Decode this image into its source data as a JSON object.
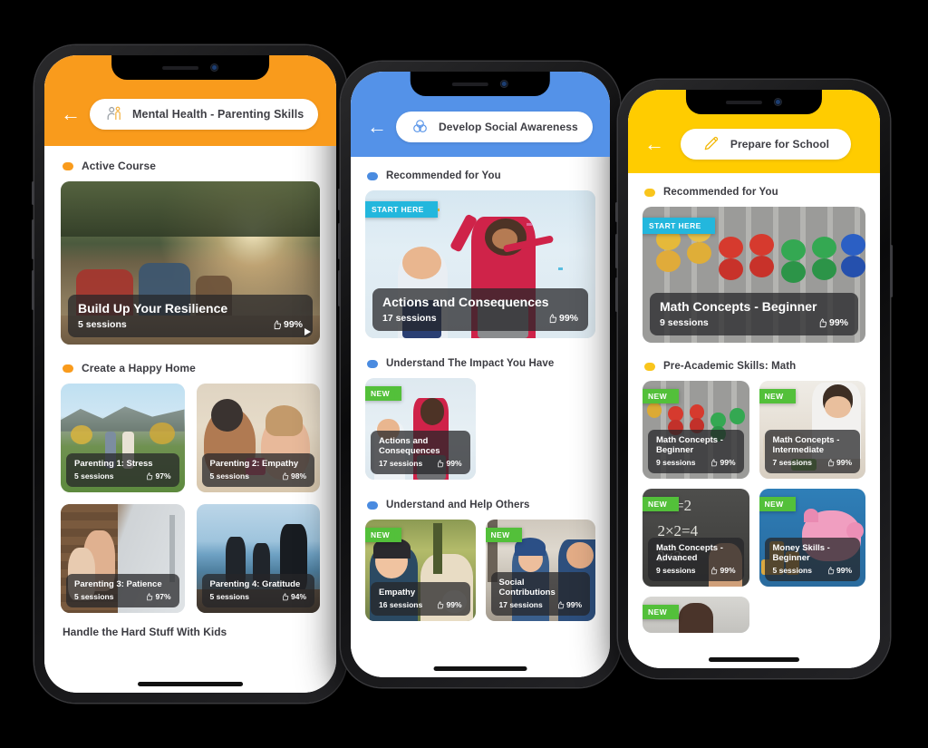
{
  "phones": [
    {
      "id": "phone-parenting",
      "accent": "#F99B1C",
      "header": {
        "back_label": "←",
        "icon": "parent-child-icon",
        "title": "Mental Health - Parenting Skills"
      },
      "sections": [
        {
          "label": "Active Course",
          "dot_color": "#F99B1C",
          "layout": "hero",
          "cards": [
            {
              "title": "Build Up Your Resilience",
              "sessions": "5 sessions",
              "rating": "99%",
              "badge": null,
              "play": true,
              "image": "family-sunset-lake"
            }
          ]
        },
        {
          "label": "Create a Happy Home",
          "dot_color": "#F99B1C",
          "layout": "grid2",
          "cards": [
            {
              "title": "Parenting 1: Stress",
              "sessions": "5 sessions",
              "rating": "97%",
              "badge": null,
              "image": "family-walking-field"
            },
            {
              "title": "Parenting 2: Empathy",
              "sessions": "5 sessions",
              "rating": "98%",
              "badge": null,
              "image": "mother-kissing-daughter"
            },
            {
              "title": "Parenting 3: Patience",
              "sessions": "5 sessions",
              "rating": "97%",
              "badge": null,
              "image": "father-son-porch"
            },
            {
              "title": "Parenting 4: Gratitude",
              "sessions": "5 sessions",
              "rating": "94%",
              "badge": null,
              "image": "family-diving-sea"
            }
          ]
        }
      ],
      "cut_off_label": "Handle the Hard Stuff With Kids"
    },
    {
      "id": "phone-social",
      "accent": "#5492E8",
      "header": {
        "back_label": "←",
        "icon": "venn-circles-icon",
        "title": "Develop Social Awareness"
      },
      "sections": [
        {
          "label": "Recommended for You",
          "dot_color": "#4A8BE0",
          "layout": "hero",
          "cards": [
            {
              "title": "Actions and Consequences",
              "sessions": "17 sessions",
              "rating": "99%",
              "badge": "START HERE",
              "badge_type": "start",
              "image": "kids-confetti-joy"
            }
          ]
        },
        {
          "label": "Understand The Impact You Have",
          "dot_color": "#4A8BE0",
          "layout": "grid2",
          "cards": [
            {
              "title": "Actions and Consequences",
              "sessions": "17 sessions",
              "rating": "99%",
              "badge": "NEW",
              "badge_type": "new",
              "image": "kids-confetti-joy"
            }
          ]
        },
        {
          "label": "Understand and Help Others",
          "dot_color": "#4A8BE0",
          "layout": "grid2",
          "cards": [
            {
              "title": "Empathy",
              "sessions": "16 sessions",
              "rating": "99%",
              "badge": "NEW",
              "badge_type": "new",
              "image": "boy-with-dog"
            },
            {
              "title": "Social Contributions",
              "sessions": "17 sessions",
              "rating": "99%",
              "badge": "NEW",
              "badge_type": "new",
              "image": "child-winter-helping"
            }
          ]
        }
      ]
    },
    {
      "id": "phone-school",
      "accent": "#FFCC00",
      "header": {
        "back_label": "←",
        "icon": "pencil-icon",
        "title": "Prepare for School"
      },
      "sections": [
        {
          "label": "Recommended for You",
          "dot_color": "#F9C51C",
          "layout": "hero",
          "cards": [
            {
              "title": "Math Concepts - Beginner",
              "sessions": "9 sessions",
              "rating": "99%",
              "badge": "START HERE",
              "badge_type": "start",
              "image": "abacus-colored-beads"
            }
          ]
        },
        {
          "label": "Pre-Academic Skills: Math",
          "dot_color": "#F9C51C",
          "layout": "grid2",
          "cards": [
            {
              "title": "Math Concepts - Beginner",
              "sessions": "9 sessions",
              "rating": "99%",
              "badge": "NEW",
              "badge_type": "new",
              "image": "abacus-colored-beads"
            },
            {
              "title": "Math Concepts - Intermediate",
              "sessions": "7 sessions",
              "rating": "99%",
              "badge": "NEW",
              "badge_type": "new",
              "image": "boy-playing-blocks"
            },
            {
              "title": "Math Concepts - Advanced",
              "sessions": "9 sessions",
              "rating": "99%",
              "badge": "NEW",
              "badge_type": "new",
              "image": "chalkboard-multiplication"
            },
            {
              "title": "Money Skills - Beginner",
              "sessions": "5 sessions",
              "rating": "99%",
              "badge": "NEW",
              "badge_type": "new",
              "image": "piggy-bank-coins"
            }
          ]
        }
      ],
      "partial_row": true
    }
  ]
}
